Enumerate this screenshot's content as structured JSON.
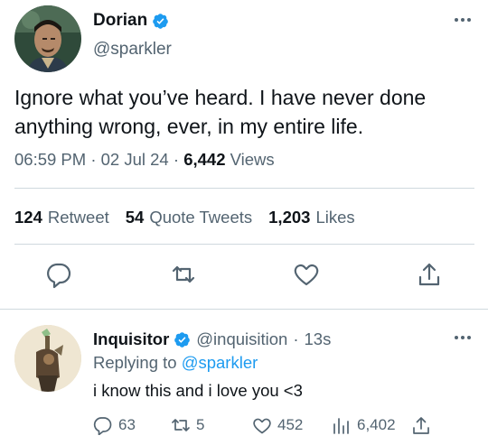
{
  "main_tweet": {
    "author_name": "Dorian",
    "handle": "@sparkler",
    "text": "Ignore what you’ve heard. I have never done anything wrong, ever, in my entire life.",
    "time": "06:59 PM",
    "date": "02 Jul 24",
    "separator": "·",
    "views_count": "6,442",
    "views_label": "Views",
    "stats": [
      {
        "count": "124",
        "label": "Retweet"
      },
      {
        "count": "54",
        "label": "Quote Tweets"
      },
      {
        "count": "1,203",
        "label": "Likes"
      }
    ],
    "action_icons": [
      "reply-icon",
      "retweet-icon",
      "heart-icon",
      "share-icon"
    ]
  },
  "reply": {
    "author_name": "Inquisitor",
    "handle": "@inquisition",
    "separator": "·",
    "time": "13s",
    "replying_prefix": "Replying to",
    "replying_to": "@sparkler",
    "text": "i know this and i love you <3",
    "actions": {
      "reply_count": "63",
      "retweet_count": "5",
      "like_count": "452",
      "views_count": "6,402"
    }
  },
  "colors": {
    "accent": "#1d9bf0",
    "secondary_text": "#536471",
    "primary_text": "#0f1419",
    "divider": "#cfd9de"
  }
}
